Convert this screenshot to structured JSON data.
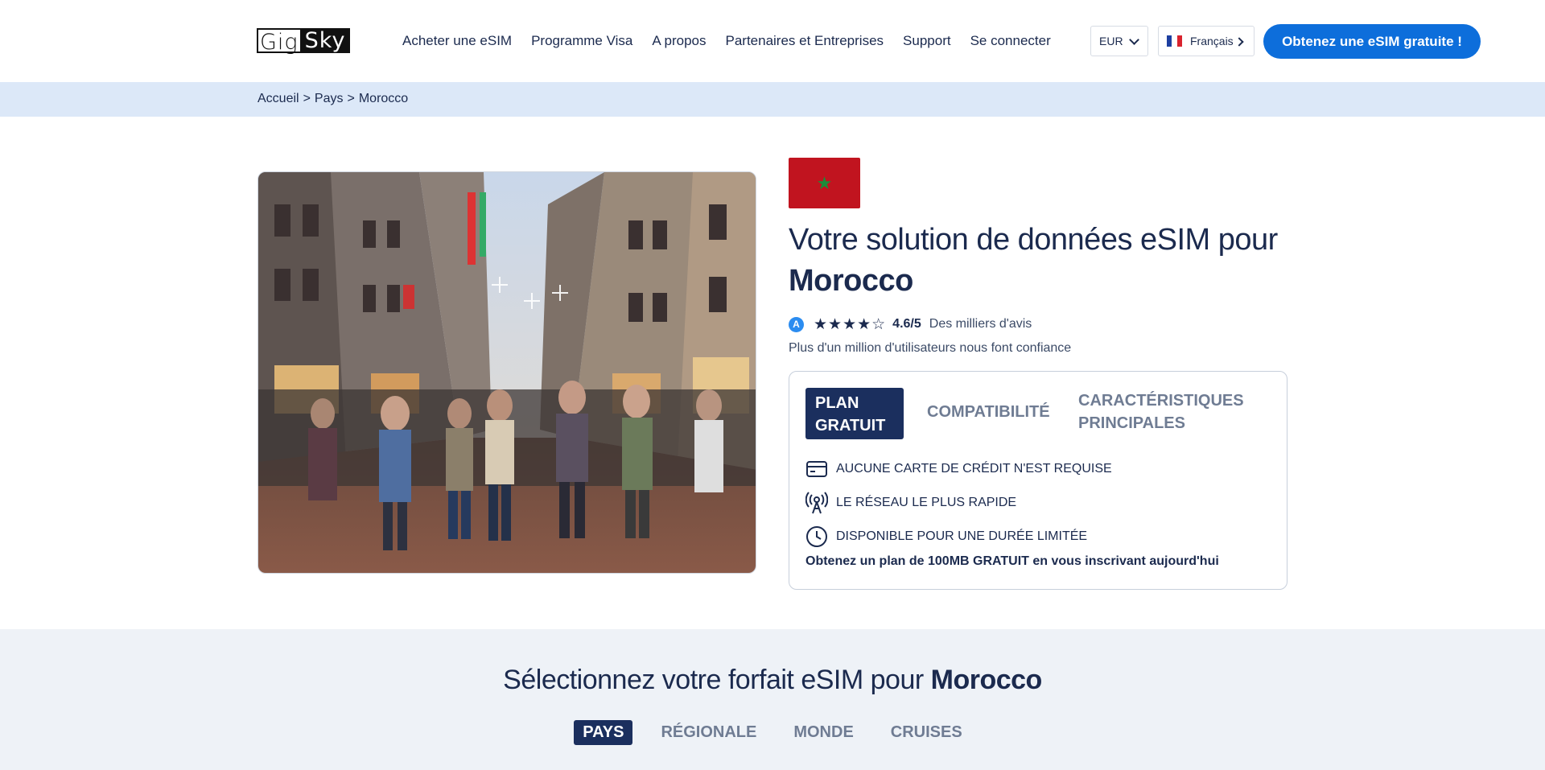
{
  "header": {
    "logo_left": "Gig",
    "logo_right": "Sky",
    "nav": [
      {
        "label": "Acheter une eSIM"
      },
      {
        "label": "Programme Visa"
      },
      {
        "label": "A propos"
      },
      {
        "label": "Partenaires et Entreprises"
      },
      {
        "label": "Support"
      },
      {
        "label": "Se connecter"
      }
    ],
    "currency": "EUR",
    "language": "Français",
    "cta": "Obtenez une eSIM gratuite !"
  },
  "breadcrumb": [
    "Accueil",
    ">",
    "Pays",
    ">",
    "Morocco"
  ],
  "hero": {
    "title_prefix": "Votre solution de données eSIM pour",
    "country": "Morocco",
    "rating_stars": "★★★★☆",
    "rating_value": 4.6,
    "rating": "4.6/5",
    "reviews": "Des milliers d'avis",
    "trust": "Plus d'un million d'utilisateurs nous font confiance"
  },
  "plan_card": {
    "tabs": [
      {
        "label": "PLAN GRATUIT",
        "active": true
      },
      {
        "label": "COMPATIBILITÉ",
        "active": false
      },
      {
        "label": "CARACTÉRISTIQUES PRINCIPALES",
        "active": false
      }
    ],
    "features": [
      {
        "icon": "credit-card-icon",
        "label": "AUCUNE CARTE DE CRÉDIT N'EST REQUISE"
      },
      {
        "icon": "antenna-icon",
        "label": "LE RÉSEAU LE PLUS RAPIDE"
      },
      {
        "icon": "clock-icon",
        "label": "DISPONIBLE POUR UNE DURÉE LIMITÉE"
      }
    ],
    "promo": "Obtenez un plan de 100MB GRATUIT en vous inscrivant aujourd'hui"
  },
  "plans_section": {
    "title_prefix": "Sélectionnez votre forfait eSIM pour",
    "country": "Morocco",
    "tabs": [
      {
        "label": "PAYS",
        "active": true
      },
      {
        "label": "RÉGIONALE",
        "active": false
      },
      {
        "label": "MONDE",
        "active": false
      },
      {
        "label": "CRUISES",
        "active": false
      }
    ]
  },
  "colors": {
    "primary": "#0d6edb",
    "navy": "#1b2f5e",
    "breadcrumb_bg": "#dce8f8",
    "flag_red": "#c1141f",
    "flag_green": "#1c8c3a"
  }
}
